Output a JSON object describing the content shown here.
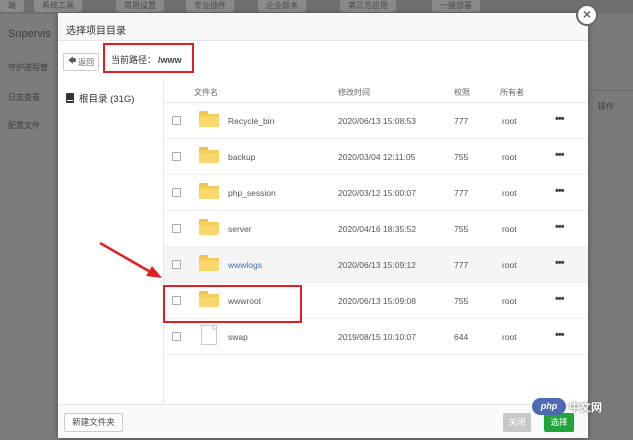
{
  "background": {
    "tabs": [
      "端",
      "系统工具",
      "常用设置",
      "专业插件",
      "企业版本",
      "第三方应用",
      "一键部署"
    ],
    "title": "Supervis",
    "sidebar": [
      "守护进程管",
      "日志查看",
      "配置文件"
    ],
    "right_label": "操作"
  },
  "dialog": {
    "title": "选择项目目录",
    "back_label": "返回",
    "path_label": "当前路径：",
    "path_value": "/www",
    "drive": "根目录 (31G)",
    "columns": {
      "name": "文件名",
      "time": "修改时间",
      "perm": "权限",
      "owner": "所有者"
    },
    "rows": [
      {
        "name": "Recycle_bin",
        "time": "2020/06/13 15:08:53",
        "perm": "777",
        "owner": "root",
        "type": "folder"
      },
      {
        "name": "backup",
        "time": "2020/03/04 12:11:05",
        "perm": "755",
        "owner": "root",
        "type": "folder"
      },
      {
        "name": "php_session",
        "time": "2020/03/12 15:00:07",
        "perm": "777",
        "owner": "root",
        "type": "folder"
      },
      {
        "name": "server",
        "time": "2020/04/16 18:35:52",
        "perm": "755",
        "owner": "root",
        "type": "folder"
      },
      {
        "name": "wwwlogs",
        "time": "2020/06/13 15:09:12",
        "perm": "777",
        "owner": "root",
        "type": "folder"
      },
      {
        "name": "wwwroot",
        "time": "2020/06/13 15:09:08",
        "perm": "755",
        "owner": "root",
        "type": "folder"
      },
      {
        "name": "swap",
        "time": "2019/08/15 10:10:07",
        "perm": "644",
        "owner": "root",
        "type": "file"
      }
    ],
    "more": "•••",
    "new_folder": "新建文件夹",
    "close": "关闭",
    "select": "选择",
    "close_icon": "×"
  },
  "watermark": {
    "logo": "php",
    "text": "中文网"
  },
  "colors": {
    "accent_green": "#20a53a",
    "highlight_red": "#e02020",
    "folder_yellow": "#f8cd56",
    "link_blue": "#3a6fb8"
  }
}
